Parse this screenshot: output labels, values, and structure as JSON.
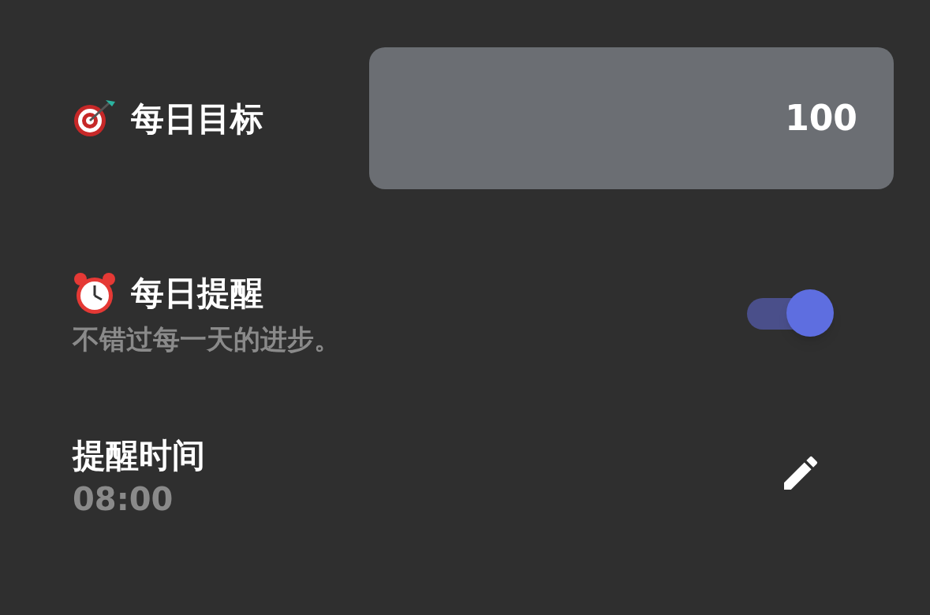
{
  "daily_goal": {
    "label": "每日目标",
    "value": "100"
  },
  "daily_reminder": {
    "label": "每日提醒",
    "description": "不错过每一天的进步。",
    "on": true
  },
  "reminder_time": {
    "label": "提醒时间",
    "value": "08:00"
  }
}
